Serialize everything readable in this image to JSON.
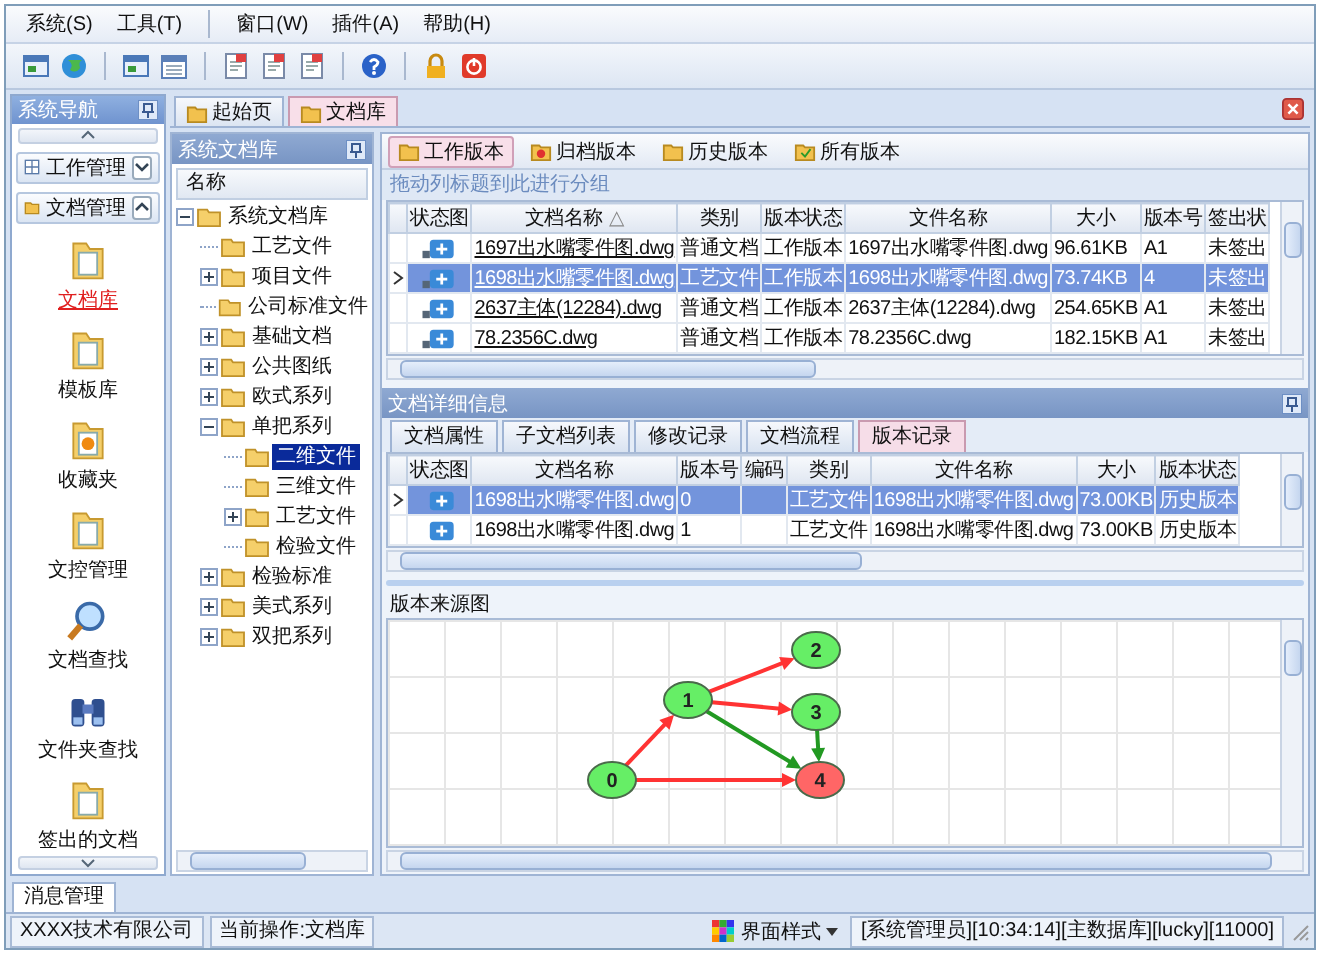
{
  "menu_groups": [
    [
      "系统(S)",
      "工具(T)"
    ],
    [
      "窗口(W)",
      "插件(A)",
      "帮助(H)"
    ]
  ],
  "nav": {
    "title": "系统导航",
    "sections": [
      {
        "label": "工作管理",
        "expanded": false
      },
      {
        "label": "文档管理",
        "expanded": true
      }
    ],
    "items": [
      {
        "label": "文档库",
        "selected": true
      },
      {
        "label": "模板库",
        "selected": false
      },
      {
        "label": "收藏夹",
        "selected": false
      },
      {
        "label": "文控管理",
        "selected": false
      },
      {
        "label": "文档查找",
        "selected": false
      },
      {
        "label": "文件夹查找",
        "selected": false
      },
      {
        "label": "签出的文档",
        "selected": false
      }
    ]
  },
  "doc_tabs": [
    {
      "label": "起始页",
      "selected": false
    },
    {
      "label": "文档库",
      "selected": true
    }
  ],
  "tree_panel": {
    "title": "系统文档库",
    "column": "名称",
    "tree": [
      {
        "label": "系统文档库",
        "expanded": true,
        "selected": false,
        "children": [
          {
            "label": "工艺文件",
            "selected": false
          },
          {
            "label": "项目文件",
            "expanded": false,
            "selected": false
          },
          {
            "label": "公司标准文件",
            "selected": false
          },
          {
            "label": "基础文档",
            "expanded": false,
            "selected": false
          },
          {
            "label": "公共图纸",
            "expanded": false,
            "selected": false
          },
          {
            "label": "欧式系列",
            "expanded": false,
            "selected": false
          },
          {
            "label": "单把系列",
            "expanded": true,
            "selected": false,
            "children": [
              {
                "label": "二维文件",
                "selected": true
              },
              {
                "label": "三维文件",
                "selected": false
              },
              {
                "label": "工艺文件",
                "expanded": false,
                "selected": false
              },
              {
                "label": "检验文件",
                "selected": false
              }
            ]
          },
          {
            "label": "检验标准",
            "expanded": false,
            "selected": false
          },
          {
            "label": "美式系列",
            "expanded": false,
            "selected": false
          },
          {
            "label": "双把系列",
            "expanded": false,
            "selected": false
          }
        ]
      }
    ]
  },
  "version_buttons": [
    {
      "label": "工作版本",
      "selected": true
    },
    {
      "label": "归档版本",
      "selected": false
    },
    {
      "label": "历史版本",
      "selected": false
    },
    {
      "label": "所有版本",
      "selected": false
    }
  ],
  "group_hint": "拖动列标题到此进行分组",
  "doc_table": {
    "columns": [
      {
        "label": "状态图"
      },
      {
        "label": "文档名称",
        "sort": "△"
      },
      {
        "label": "类别"
      },
      {
        "label": "版本状态"
      },
      {
        "label": "文件名称"
      },
      {
        "label": "大小"
      },
      {
        "label": "版本号"
      },
      {
        "label": "签出状"
      }
    ],
    "rows": [
      {
        "selected": false,
        "cells": [
          "",
          "1697出水嘴零件图.dwg",
          "普通文档",
          "工作版本",
          "1697出水嘴零件图.dwg",
          "96.61KB",
          "A1",
          "未签出"
        ]
      },
      {
        "selected": true,
        "cells": [
          "",
          "1698出水嘴零件图.dwg",
          "工艺文件",
          "工作版本",
          "1698出水嘴零件图.dwg",
          "73.74KB",
          "4",
          "未签出"
        ]
      },
      {
        "selected": false,
        "cells": [
          "",
          "2637主体(12284).dwg",
          "普通文档",
          "工作版本",
          "2637主体(12284).dwg",
          "254.65KB",
          "A1",
          "未签出"
        ]
      },
      {
        "selected": false,
        "cells": [
          "",
          "78.2356C.dwg",
          "普通文档",
          "工作版本",
          "78.2356C.dwg",
          "182.15KB",
          "A1",
          "未签出"
        ]
      }
    ]
  },
  "detail": {
    "title": "文档详细信息",
    "tabs": [
      {
        "label": "文档属性",
        "selected": false
      },
      {
        "label": "子文档列表",
        "selected": false
      },
      {
        "label": "修改记录",
        "selected": false
      },
      {
        "label": "文档流程",
        "selected": false
      },
      {
        "label": "版本记录",
        "selected": true
      }
    ],
    "table": {
      "columns": [
        "状态图",
        "文档名称",
        "版本号",
        "编码",
        "类别",
        "文件名称",
        "大小",
        "版本状态"
      ],
      "rows": [
        {
          "selected": true,
          "cells": [
            "",
            "1698出水嘴零件图.dwg",
            "0",
            "",
            "工艺文件",
            "1698出水嘴零件图.dwg",
            "73.00KB",
            "历史版本"
          ]
        },
        {
          "selected": false,
          "cells": [
            "",
            "1698出水嘴零件图.dwg",
            "1",
            "",
            "工艺文件",
            "1698出水嘴零件图.dwg",
            "73.00KB",
            "历史版本"
          ]
        }
      ]
    },
    "graph": {
      "title": "版本来源图",
      "nodes": [
        {
          "label": "0",
          "color": "#66ee66"
        },
        {
          "label": "1",
          "color": "#66ee66"
        },
        {
          "label": "2",
          "color": "#66ee66"
        },
        {
          "label": "3",
          "color": "#66ee66"
        },
        {
          "label": "4",
          "color": "#ff6666"
        }
      ],
      "edges": [
        {
          "color": "#ff3333"
        },
        {
          "color": "#ff3333"
        },
        {
          "color": "#ff3333"
        },
        {
          "color": "#ff3333"
        },
        {
          "color": "#229922"
        },
        {
          "color": "#229922"
        }
      ]
    }
  },
  "bottom_tabs": [
    {
      "label": "消息管理",
      "selected": true
    }
  ],
  "status_bar": {
    "company": "XXXX技术有限公司",
    "operation": "当前操作:文档库",
    "style_button": "界面样式",
    "info": "[系统管理员][10:34:14][主数据库][lucky][11000]"
  }
}
